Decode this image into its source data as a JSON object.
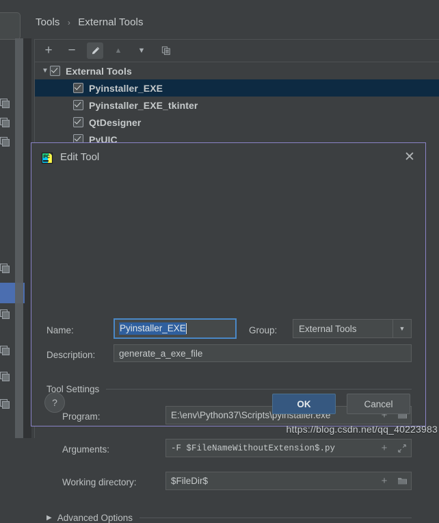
{
  "breadcrumb": {
    "parent": "Tools",
    "separator": "›",
    "current": "External Tools"
  },
  "toolbar": {
    "add_label": "+",
    "remove_label": "−",
    "edit_label": "edit-pencil-icon",
    "move_up_label": "▲",
    "move_down_label": "▼",
    "copy_label": "copy-icon"
  },
  "tree": {
    "rows": [
      {
        "label": "External Tools",
        "level": 1,
        "checked": true,
        "expanded": true,
        "selected": false
      },
      {
        "label": "Pyinstaller_EXE",
        "level": 2,
        "checked": true,
        "selected": true
      },
      {
        "label": "Pyinstaller_EXE_tkinter",
        "level": 2,
        "checked": true,
        "selected": false
      },
      {
        "label": "QtDesigner",
        "level": 2,
        "checked": true,
        "selected": false
      },
      {
        "label": "PyUIC",
        "level": 2,
        "checked": true,
        "selected": false
      }
    ]
  },
  "dialog": {
    "title": "Edit Tool",
    "app_icon": "pycharm-icon",
    "close_label": "✕",
    "name": {
      "label": "Name:",
      "value": "Pyinstaller_EXE",
      "placeholder": ""
    },
    "group": {
      "label": "Group:",
      "value": "External Tools",
      "arrow": "▼"
    },
    "description": {
      "label": "Description:",
      "value": "generate_a_exe_file",
      "placeholder": ""
    },
    "tool_settings": {
      "header": "Tool Settings",
      "fields": [
        {
          "label": "Program:",
          "value": "E:\\env\\Python37\\Scripts\\pyinstaller.exe",
          "mono": false,
          "btn1": "+",
          "btn2": "folder-icon"
        },
        {
          "label": "Arguments:",
          "value": "-F $FileNameWithoutExtension$.py",
          "mono": true,
          "btn1": "+",
          "btn2": "expand-icon"
        },
        {
          "label": "Working directory:",
          "value": "$FileDir$",
          "mono": false,
          "btn1": "+",
          "btn2": "folder-icon"
        }
      ]
    },
    "advanced_options": {
      "label": "Advanced Options",
      "disclosure": "▶",
      "expanded": false
    },
    "help_label": "?",
    "ok_label": "OK",
    "cancel_label": "Cancel"
  },
  "watermark": {
    "text": "https://blog.csdn.net/qq_40223983"
  },
  "colors": {
    "window_bg": "#3c3f41",
    "dialog_border": "#8b84c8",
    "selection_navy": "#0d2a42",
    "sidebar_selection_blue": "#4b6eb0",
    "focus_blue": "#4a88c7",
    "text_selection_blue": "#2f5f9e",
    "ok_button_blue": "#365880"
  }
}
